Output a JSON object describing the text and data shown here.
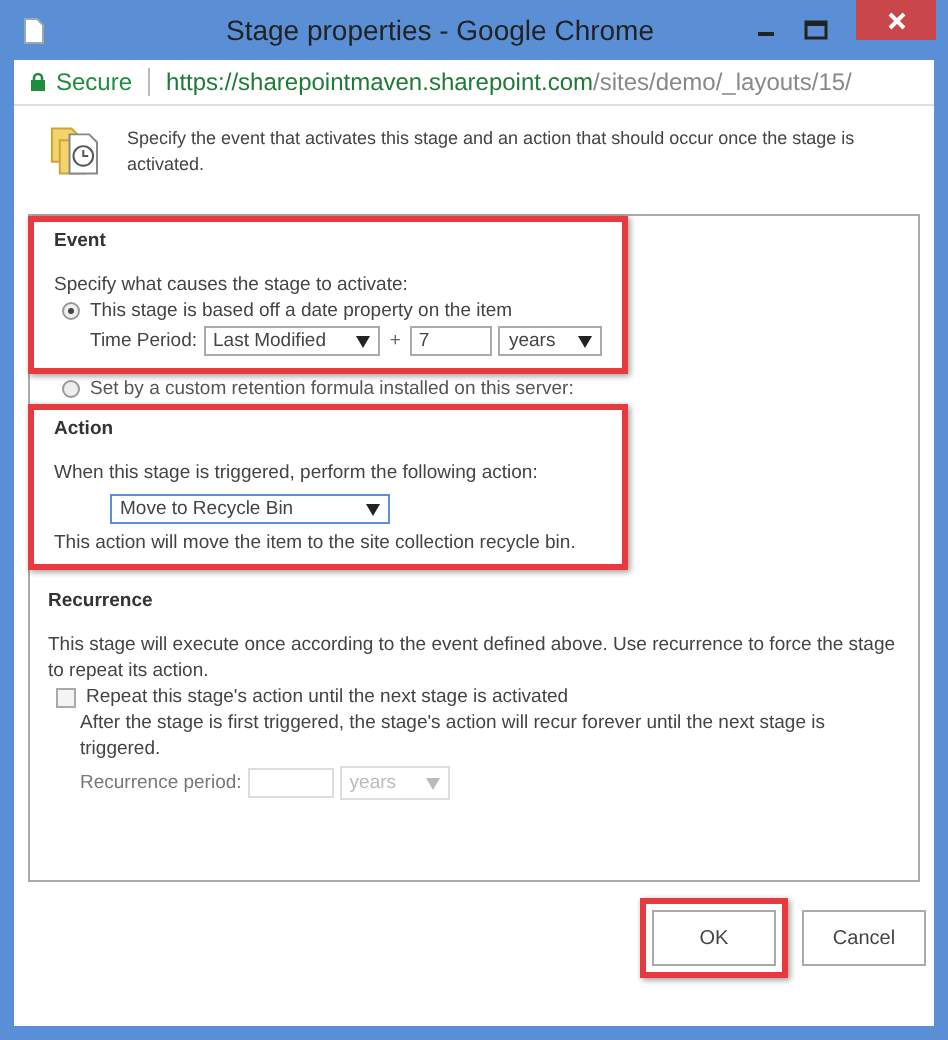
{
  "window": {
    "title": "Stage properties - Google Chrome"
  },
  "address_bar": {
    "secure_label": "Secure",
    "url_host": "https://sharepointmaven.sharepoint.com",
    "url_path": "/sites/demo/_layouts/15/"
  },
  "intro": "Specify the event that activates this stage and an action that should occur once the stage is activated.",
  "event": {
    "heading": "Event",
    "highlighted": true,
    "prompt": "Specify what causes the stage to activate:",
    "options": [
      {
        "label": "This stage is based off a date property on the item",
        "selected": true
      },
      {
        "label": "Set by a custom retention formula installed on this server:",
        "selected": false
      }
    ],
    "time_period_label": "Time Period:",
    "property": "Last Modified",
    "plus": "+",
    "amount": "7",
    "unit": "years"
  },
  "action": {
    "heading": "Action",
    "highlighted": true,
    "prompt": "When this stage is triggered, perform the following action:",
    "value": "Move to Recycle Bin",
    "note": "This action will move the item to the site collection recycle bin."
  },
  "recurrence": {
    "heading": "Recurrence",
    "highlighted": false,
    "description": "This stage will execute once according to the event defined above. Use recurrence to force the stage to repeat its action.",
    "checkbox": {
      "label": "Repeat this stage's action until the next stage is activated",
      "checked": false
    },
    "detail": "After the stage is first triggered, the stage's action will recur forever until the next stage is triggered.",
    "period_label": "Recurrence period:",
    "period_unit": "years",
    "disabled": true
  },
  "buttons": [
    {
      "label": "OK",
      "highlighted": true
    },
    {
      "label": "Cancel",
      "highlighted": false
    }
  ]
}
